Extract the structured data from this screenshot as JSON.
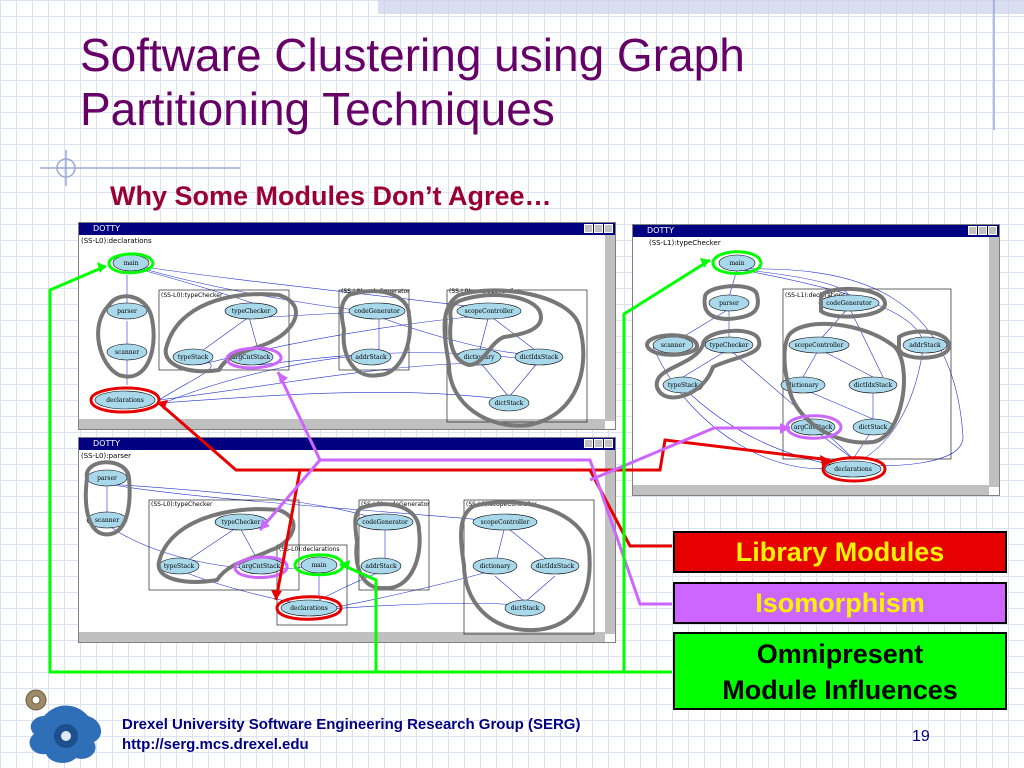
{
  "title": "Software Clustering using Graph Partitioning Techniques",
  "subtitle": "Why Some Modules Don’t Agree…",
  "windows": [
    {
      "name": "win-left-top",
      "title": "DOTTY",
      "caption": "(SS-L0):declarations"
    },
    {
      "name": "win-left-bottom",
      "title": "DOTTY",
      "caption": "(SS-L0):parser"
    },
    {
      "name": "win-right",
      "title": "DOTTY",
      "caption": "(SS-L1):typeChecker"
    }
  ],
  "clusters": {
    "w1": [
      "(SS-L0):typeChecker",
      "(SS-L0):codeGenerator",
      "(SS-L0):scopeController"
    ],
    "w2": [
      "(SS-L0):typeChecker",
      "(SS-L0):codeGenerator",
      "(SS-L0):scopeController",
      "(SS-L0):declarations"
    ],
    "w3": [
      "(SS-L1):declarations"
    ]
  },
  "nodes": {
    "main": "main",
    "parser": "parser",
    "scanner": "scanner",
    "declarations": "declarations",
    "typeChecker": "typeChecker",
    "typeStack": "typeStack",
    "argCntStack": "argCntStack",
    "codeGenerator": "codeGenerator",
    "addrStack": "addrStack",
    "scopeController": "scopeController",
    "dictionary": "dictionary",
    "dictIdxStack": "dictIdxStack",
    "dictStack": "dictStack"
  },
  "legend": {
    "library": "Library Modules",
    "isomorphism": "Isomorphism",
    "omnipresent_line1": "Omnipresent",
    "omnipresent_line2": "Module Influences"
  },
  "colors": {
    "library": "#e60000",
    "isomorphism": "#cc66ff",
    "omnipresent": "#00ff00",
    "title": "#660066",
    "subtitle": "#990033",
    "footer": "#000080"
  },
  "footer": {
    "org": "Drexel University Software Engineering Research Group (SERG)",
    "url": "http://serg.mcs.drexel.edu",
    "page": "19"
  }
}
